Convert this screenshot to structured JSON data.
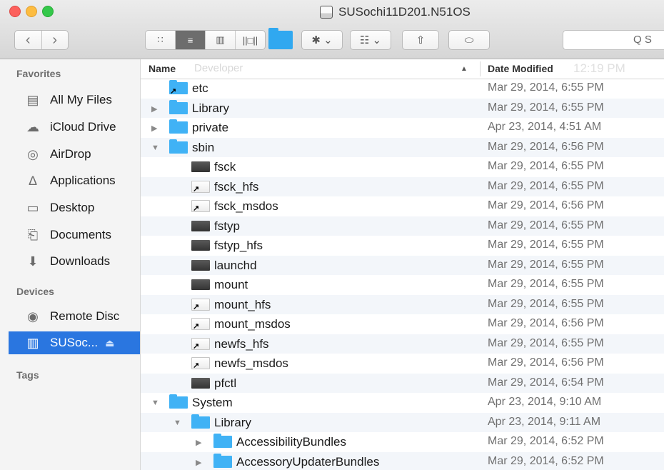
{
  "window": {
    "title": "SUSochi11D201.N51OS"
  },
  "toolbar": {
    "back": "‹",
    "forward": "›",
    "view_icons": "∷",
    "view_list": "≡",
    "view_columns": "▥",
    "view_coverflow": "||□||",
    "action": "✱ ⌄",
    "arrange": "☷ ⌄",
    "share": "⇧",
    "tag": "⬭",
    "search_placeholder": "Q S"
  },
  "sidebar": {
    "favorites_label": "Favorites",
    "favorites": [
      {
        "label": "All My Files",
        "icon": "all-files-icon",
        "glyph": "▤"
      },
      {
        "label": "iCloud Drive",
        "icon": "cloud-icon",
        "glyph": "☁"
      },
      {
        "label": "AirDrop",
        "icon": "airdrop-icon",
        "glyph": "◎"
      },
      {
        "label": "Applications",
        "icon": "applications-icon",
        "glyph": "∆"
      },
      {
        "label": "Desktop",
        "icon": "desktop-icon",
        "glyph": "▭"
      },
      {
        "label": "Documents",
        "icon": "documents-icon",
        "glyph": "⎗"
      },
      {
        "label": "Downloads",
        "icon": "downloads-icon",
        "glyph": "⬇"
      }
    ],
    "devices_label": "Devices",
    "devices": [
      {
        "label": "Remote Disc",
        "icon": "remote-disc-icon",
        "glyph": "◉"
      },
      {
        "label": "SUSoc...",
        "icon": "disk-icon",
        "glyph": "▥",
        "selected": true,
        "eject": "⏏"
      }
    ],
    "tags_label": "Tags"
  },
  "header": {
    "name_col": "Name",
    "name_ghost": "Developer",
    "sort_indicator": "▲",
    "date_col": "Date Modified",
    "date_ghost": "12:19 PM"
  },
  "files": [
    {
      "name": "etc",
      "date": "Mar 29, 2014, 6:55 PM",
      "depth": 0,
      "type": "folder-alias",
      "disclosure": ""
    },
    {
      "name": "Library",
      "date": "Mar 29, 2014, 6:55 PM",
      "depth": 0,
      "type": "folder",
      "disclosure": "▶"
    },
    {
      "name": "private",
      "date": "Apr 23, 2014, 4:51 AM",
      "depth": 0,
      "type": "folder",
      "disclosure": "▶"
    },
    {
      "name": "sbin",
      "date": "Mar 29, 2014, 6:56 PM",
      "depth": 0,
      "type": "folder",
      "disclosure": "▼"
    },
    {
      "name": "fsck",
      "date": "Mar 29, 2014, 6:55 PM",
      "depth": 1,
      "type": "exec",
      "disclosure": ""
    },
    {
      "name": "fsck_hfs",
      "date": "Mar 29, 2014, 6:55 PM",
      "depth": 1,
      "type": "alias",
      "disclosure": ""
    },
    {
      "name": "fsck_msdos",
      "date": "Mar 29, 2014, 6:56 PM",
      "depth": 1,
      "type": "alias",
      "disclosure": ""
    },
    {
      "name": "fstyp",
      "date": "Mar 29, 2014, 6:55 PM",
      "depth": 1,
      "type": "exec",
      "disclosure": ""
    },
    {
      "name": "fstyp_hfs",
      "date": "Mar 29, 2014, 6:55 PM",
      "depth": 1,
      "type": "exec",
      "disclosure": ""
    },
    {
      "name": "launchd",
      "date": "Mar 29, 2014, 6:55 PM",
      "depth": 1,
      "type": "exec",
      "disclosure": ""
    },
    {
      "name": "mount",
      "date": "Mar 29, 2014, 6:55 PM",
      "depth": 1,
      "type": "exec",
      "disclosure": ""
    },
    {
      "name": "mount_hfs",
      "date": "Mar 29, 2014, 6:55 PM",
      "depth": 1,
      "type": "alias",
      "disclosure": ""
    },
    {
      "name": "mount_msdos",
      "date": "Mar 29, 2014, 6:56 PM",
      "depth": 1,
      "type": "alias",
      "disclosure": ""
    },
    {
      "name": "newfs_hfs",
      "date": "Mar 29, 2014, 6:55 PM",
      "depth": 1,
      "type": "alias",
      "disclosure": ""
    },
    {
      "name": "newfs_msdos",
      "date": "Mar 29, 2014, 6:56 PM",
      "depth": 1,
      "type": "alias",
      "disclosure": ""
    },
    {
      "name": "pfctl",
      "date": "Mar 29, 2014, 6:54 PM",
      "depth": 1,
      "type": "exec",
      "disclosure": ""
    },
    {
      "name": "System",
      "date": "Apr 23, 2014, 9:10 AM",
      "depth": 0,
      "type": "folder",
      "disclosure": "▼"
    },
    {
      "name": "Library",
      "date": "Apr 23, 2014, 9:11 AM",
      "depth": 1,
      "type": "folder",
      "disclosure": "▼"
    },
    {
      "name": "AccessibilityBundles",
      "date": "Mar 29, 2014, 6:52 PM",
      "depth": 2,
      "type": "folder",
      "disclosure": "▶"
    },
    {
      "name": "AccessoryUpdaterBundles",
      "date": "Mar 29, 2014, 6:52 PM",
      "depth": 2,
      "type": "folder",
      "disclosure": "▶"
    }
  ]
}
